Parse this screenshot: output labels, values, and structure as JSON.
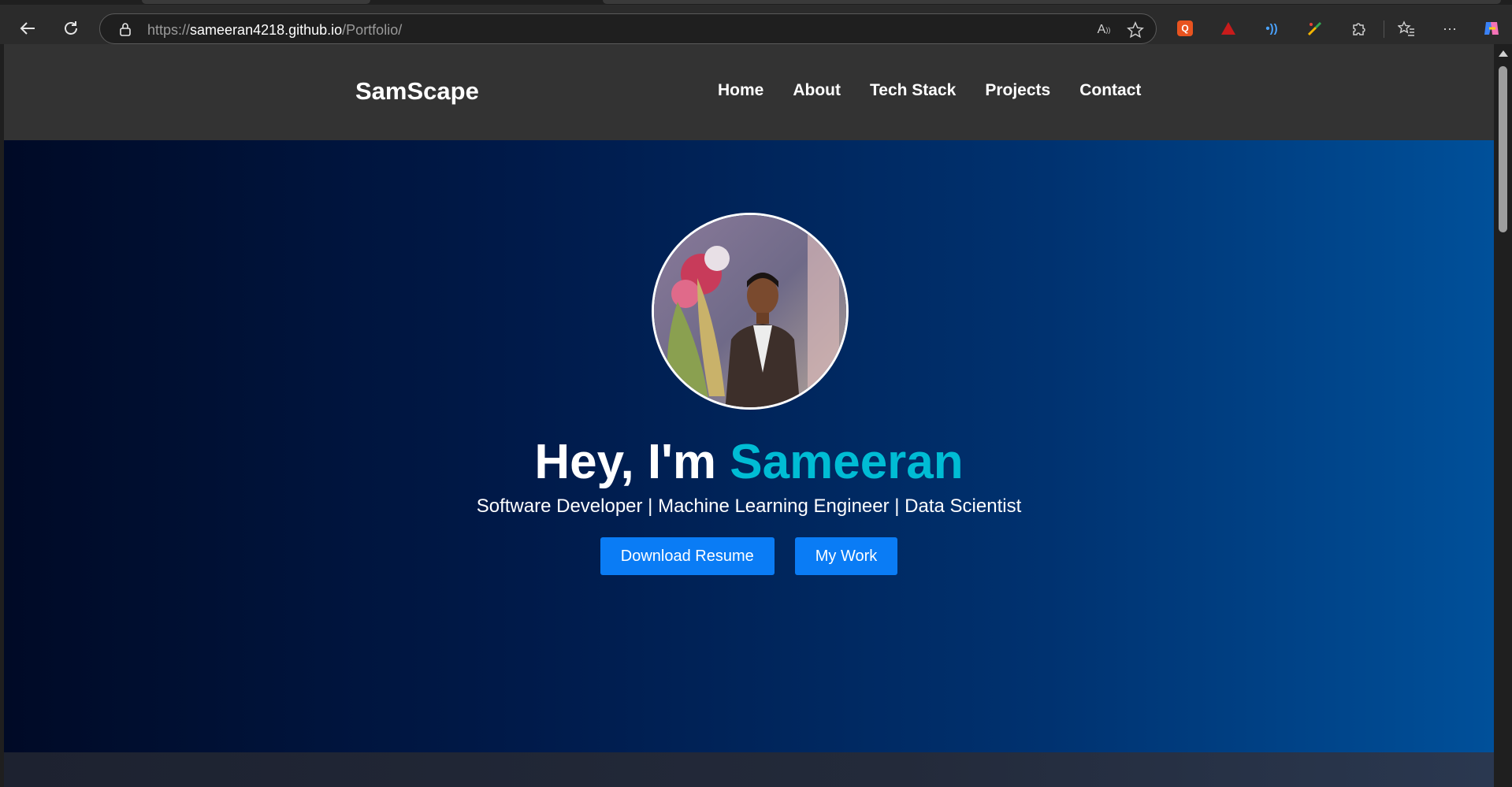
{
  "browser": {
    "url_scheme": "https://",
    "url_host": "sameeran4218.github.io",
    "url_path": "/Portfolio/",
    "icons": [
      "back-arrow-icon",
      "refresh-icon",
      "lock-icon",
      "read-aloud-icon",
      "favorite-star-icon",
      "extension-q-icon",
      "extension-red-icon",
      "extension-wave-icon",
      "extension-color-picker-icon",
      "extensions-puzzle-icon",
      "favorites-list-icon",
      "more-dots-icon",
      "copilot-icon"
    ]
  },
  "site": {
    "brand": "SamScape",
    "nav": [
      {
        "label": "Home"
      },
      {
        "label": "About"
      },
      {
        "label": "Tech Stack"
      },
      {
        "label": "Projects"
      },
      {
        "label": "Contact"
      }
    ]
  },
  "hero": {
    "greeting": "Hey, I'm ",
    "name": "Sameeran",
    "subtitle": "Software Developer | Machine Learning Engineer | Data Scientist",
    "primary_button": "Download Resume",
    "secondary_button": "My Work",
    "accent_color": "#00bcd4",
    "button_color": "#0a7cf5"
  }
}
